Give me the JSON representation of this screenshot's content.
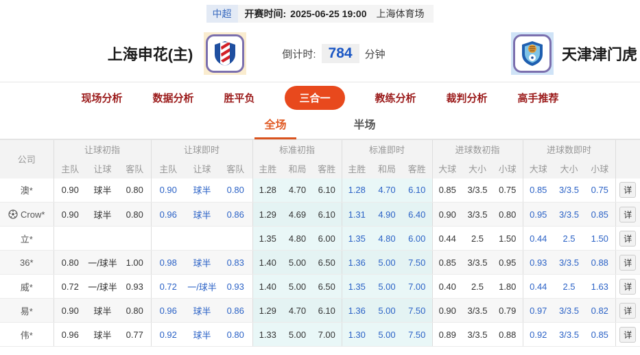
{
  "match_header": {
    "league": "中超",
    "kickoff_label": "开赛时间:",
    "kickoff_time": "2025-06-25 19:00",
    "venue": "上海体育场",
    "home_team": "上海申花(主)",
    "away_team": "天津津门虎",
    "countdown_label": "倒计时:",
    "countdown_value": "784",
    "countdown_unit": "分钟"
  },
  "nav_tabs": [
    {
      "label": "现场分析",
      "active": false
    },
    {
      "label": "数据分析",
      "active": false
    },
    {
      "label": "胜平负",
      "active": false
    },
    {
      "label": "三合一",
      "active": true
    },
    {
      "label": "教练分析",
      "active": false
    },
    {
      "label": "裁判分析",
      "active": false
    },
    {
      "label": "高手推荐",
      "active": false
    }
  ],
  "sub_tabs": [
    {
      "label": "全场",
      "active": true
    },
    {
      "label": "半场",
      "active": false
    }
  ],
  "table": {
    "company_header": "公司",
    "detail_label": "详",
    "groups": [
      {
        "label": "让球初指",
        "cols": [
          "主队",
          "让球",
          "客队"
        ]
      },
      {
        "label": "让球即时",
        "cols": [
          "主队",
          "让球",
          "客队"
        ]
      },
      {
        "label": "标准初指",
        "cols": [
          "主胜",
          "和局",
          "客胜"
        ]
      },
      {
        "label": "标准即时",
        "cols": [
          "主胜",
          "和局",
          "客胜"
        ]
      },
      {
        "label": "进球数初指",
        "cols": [
          "大球",
          "大小",
          "小球"
        ]
      },
      {
        "label": "进球数即时",
        "cols": [
          "大球",
          "大小",
          "小球"
        ]
      }
    ],
    "rows": [
      {
        "company": "澳*",
        "icon": null,
        "handicap_initial": [
          "0.90",
          "球半",
          "0.80"
        ],
        "handicap_live": [
          "0.90",
          "球半",
          "0.80"
        ],
        "standard_initial": [
          "1.28",
          "4.70",
          "6.10"
        ],
        "standard_live": [
          "1.28",
          "4.70",
          "6.10"
        ],
        "goals_initial": [
          "0.85",
          "3/3.5",
          "0.75"
        ],
        "goals_live": [
          "0.85",
          "3/3.5",
          "0.75"
        ]
      },
      {
        "company": "Crow*",
        "icon": "soccer-ball-icon",
        "handicap_initial": [
          "0.90",
          "球半",
          "0.80"
        ],
        "handicap_live": [
          "0.96",
          "球半",
          "0.86"
        ],
        "standard_initial": [
          "1.29",
          "4.69",
          "6.10"
        ],
        "standard_live": [
          "1.31",
          "4.90",
          "6.40"
        ],
        "goals_initial": [
          "0.90",
          "3/3.5",
          "0.80"
        ],
        "goals_live": [
          "0.95",
          "3/3.5",
          "0.85"
        ]
      },
      {
        "company": "立*",
        "icon": null,
        "handicap_initial": [
          "",
          "",
          ""
        ],
        "handicap_live": [
          "",
          "",
          ""
        ],
        "standard_initial": [
          "1.35",
          "4.80",
          "6.00"
        ],
        "standard_live": [
          "1.35",
          "4.80",
          "6.00"
        ],
        "goals_initial": [
          "0.44",
          "2.5",
          "1.50"
        ],
        "goals_live": [
          "0.44",
          "2.5",
          "1.50"
        ]
      },
      {
        "company": "36*",
        "icon": null,
        "handicap_initial": [
          "0.80",
          "一/球半",
          "1.00"
        ],
        "handicap_live": [
          "0.98",
          "球半",
          "0.83"
        ],
        "standard_initial": [
          "1.40",
          "5.00",
          "6.50"
        ],
        "standard_live": [
          "1.36",
          "5.00",
          "7.50"
        ],
        "goals_initial": [
          "0.85",
          "3/3.5",
          "0.95"
        ],
        "goals_live": [
          "0.93",
          "3/3.5",
          "0.88"
        ]
      },
      {
        "company": "威*",
        "icon": null,
        "handicap_initial": [
          "0.72",
          "一/球半",
          "0.93"
        ],
        "handicap_live": [
          "0.72",
          "一/球半",
          "0.93"
        ],
        "standard_initial": [
          "1.40",
          "5.00",
          "6.50"
        ],
        "standard_live": [
          "1.35",
          "5.00",
          "7.00"
        ],
        "goals_initial": [
          "0.40",
          "2.5",
          "1.80"
        ],
        "goals_live": [
          "0.44",
          "2.5",
          "1.63"
        ]
      },
      {
        "company": "易*",
        "icon": null,
        "handicap_initial": [
          "0.90",
          "球半",
          "0.80"
        ],
        "handicap_live": [
          "0.96",
          "球半",
          "0.86"
        ],
        "standard_initial": [
          "1.29",
          "4.70",
          "6.10"
        ],
        "standard_live": [
          "1.36",
          "5.00",
          "7.50"
        ],
        "goals_initial": [
          "0.90",
          "3/3.5",
          "0.79"
        ],
        "goals_live": [
          "0.97",
          "3/3.5",
          "0.82"
        ]
      },
      {
        "company": "伟*",
        "icon": null,
        "handicap_initial": [
          "0.96",
          "球半",
          "0.77"
        ],
        "handicap_live": [
          "0.92",
          "球半",
          "0.80"
        ],
        "standard_initial": [
          "1.33",
          "5.00",
          "7.00"
        ],
        "standard_live": [
          "1.30",
          "5.00",
          "7.50"
        ],
        "goals_initial": [
          "0.89",
          "3/3.5",
          "0.88"
        ],
        "goals_live": [
          "0.92",
          "3/3.5",
          "0.85"
        ]
      }
    ]
  },
  "colors": {
    "accent_pill_orange": "#e8491d",
    "active_subtab_orange": "#e05a24",
    "live_odds_blue": "#2b62c6",
    "standard_highlight_cyan": "#e9f7f7",
    "league_blue": "#3a6bbf",
    "countdown_blue": "#1a56c4",
    "nav_text_red": "#9b1b1b"
  }
}
